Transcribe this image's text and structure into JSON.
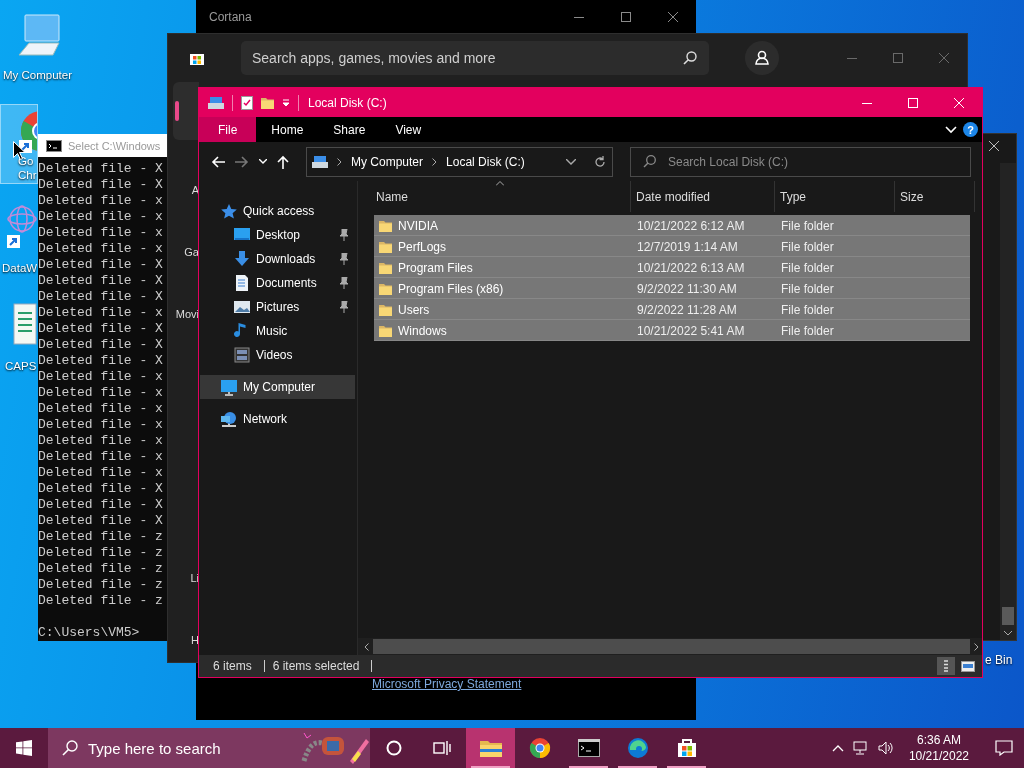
{
  "desktop_icons": [
    {
      "label_lines": [
        "My Computer"
      ],
      "selected": false
    },
    {
      "label_lines": [
        "Go",
        "Chr"
      ],
      "selected": true
    },
    {
      "label_lines": [
        "DataW"
      ],
      "selected": false
    },
    {
      "label_lines": [
        "CAPS"
      ],
      "selected": false
    }
  ],
  "recycle_bin_label": "e Bin",
  "cortana": {
    "title": "Cortana",
    "privacy_link": "Microsoft Privacy Statement"
  },
  "store": {
    "search_placeholder": "Search apps, games, movies and more",
    "sidebar_labels": [
      "A",
      "Ga",
      "Movi",
      "Li",
      "H"
    ]
  },
  "cmd": {
    "title": "Select C:\\Windows",
    "lines": [
      "Deleted file - X",
      "Deleted file - X",
      "Deleted file - x",
      "Deleted file - x",
      "Deleted file - x",
      "Deleted file - x",
      "Deleted file - X",
      "Deleted file - X",
      "Deleted file - X",
      "Deleted file - x",
      "Deleted file - X",
      "Deleted file - X",
      "Deleted file - X",
      "Deleted file - x",
      "Deleted file - x",
      "Deleted file - x",
      "Deleted file - x",
      "Deleted file - x",
      "Deleted file - x",
      "Deleted file - x",
      "Deleted file - X",
      "Deleted file - X",
      "Deleted file - X",
      "Deleted file - z",
      "Deleted file - z",
      "Deleted file - z",
      "Deleted file - z",
      "Deleted file - z"
    ],
    "prompt": "C:\\Users\\VM5>"
  },
  "explorer": {
    "title": "Local Disk (C:)",
    "ribbon_tabs": [
      {
        "label": "File",
        "selected": true
      },
      {
        "label": "Home",
        "selected": false
      },
      {
        "label": "Share",
        "selected": false
      },
      {
        "label": "View",
        "selected": false
      }
    ],
    "help": "?",
    "breadcrumb": [
      "My Computer",
      "Local Disk (C:)"
    ],
    "search_placeholder": "Search Local Disk (C:)",
    "nav": [
      {
        "label": "Quick access",
        "selected": false,
        "children": [
          {
            "label": "Desktop",
            "pinned": true,
            "selected": false
          },
          {
            "label": "Downloads",
            "pinned": true,
            "selected": false
          },
          {
            "label": "Documents",
            "pinned": true,
            "selected": false
          },
          {
            "label": "Pictures",
            "pinned": true,
            "selected": false
          },
          {
            "label": "Music",
            "pinned": false,
            "selected": false
          },
          {
            "label": "Videos",
            "pinned": false,
            "selected": false
          }
        ]
      },
      {
        "label": "My Computer",
        "selected": true
      },
      {
        "label": "Network",
        "selected": false
      }
    ],
    "columns": [
      {
        "label": "Name",
        "sorted": true
      },
      {
        "label": "Date modified",
        "sorted": false
      },
      {
        "label": "Type",
        "sorted": false
      },
      {
        "label": "Size",
        "sorted": false
      }
    ],
    "rows": [
      {
        "name": "NVIDIA",
        "date": "10/21/2022 6:12 AM",
        "type": "File folder",
        "selected": true
      },
      {
        "name": "PerfLogs",
        "date": "12/7/2019 1:14 AM",
        "type": "File folder",
        "selected": true
      },
      {
        "name": "Program Files",
        "date": "10/21/2022 6:13 AM",
        "type": "File folder",
        "selected": true
      },
      {
        "name": "Program Files (x86)",
        "date": "9/2/2022 11:30 AM",
        "type": "File folder",
        "selected": true
      },
      {
        "name": "Users",
        "date": "9/2/2022 11:28 AM",
        "type": "File folder",
        "selected": true
      },
      {
        "name": "Windows",
        "date": "10/21/2022 5:41 AM",
        "type": "File folder",
        "selected": true
      }
    ],
    "status": {
      "item_count": "6 items",
      "selection": "6 items selected"
    }
  },
  "taskbar": {
    "search_placeholder": "Type here to search",
    "apps": [
      {
        "running": true,
        "active": true
      },
      {
        "running": false,
        "active": false
      },
      {
        "running": true,
        "active": false
      },
      {
        "running": true,
        "active": false
      },
      {
        "running": true,
        "active": false
      }
    ],
    "time": "6:36 AM",
    "date": "10/21/2022"
  }
}
